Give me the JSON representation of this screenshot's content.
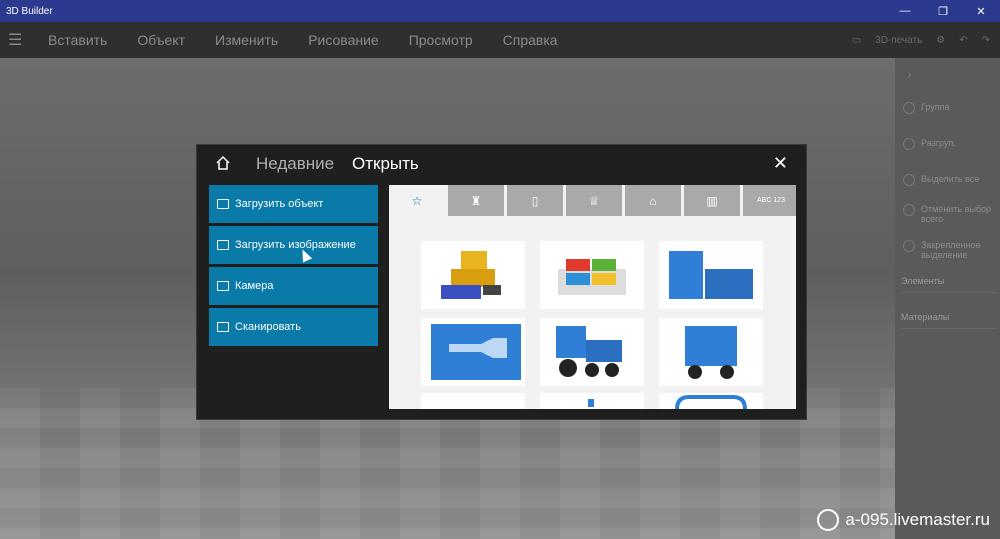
{
  "window": {
    "title": "3D Builder",
    "controls": [
      "—",
      "❐",
      "✕"
    ]
  },
  "menu": {
    "items": [
      "Вставить",
      "Объект",
      "Изменить",
      "Рисование",
      "Просмотр",
      "Справка"
    ],
    "print_label": "3D-печать"
  },
  "right_panel": {
    "items": [
      "Группа",
      "Разгруп.",
      "Выделить все",
      "Отменить выбор всего",
      "Закрепленное выделение"
    ],
    "sections": [
      "Элементы",
      "Материалы"
    ]
  },
  "dialog": {
    "tab_recent": "Недавние",
    "tab_open": "Открыть",
    "actions": [
      "Загрузить объект",
      "Загрузить изображение",
      "Камера",
      "Сканировать"
    ],
    "category_icons": [
      "star-icon",
      "robot-icon",
      "tag-icon",
      "trophy-icon",
      "house-icon",
      "buildings-icon",
      "text-icon"
    ],
    "text_tab_label": "ABC 123",
    "thumbnails": [
      "bulldozer",
      "windows-logo",
      "phone-stand",
      "bottle-mold",
      "train-engine",
      "train-wagon",
      "item-7",
      "item-8",
      "item-9"
    ]
  },
  "watermark": "a-095.livemaster.ru",
  "colors": {
    "titlebar": "#2b3a8f",
    "accent": "#0a7aa8",
    "model_blue": "#2f7fd6"
  }
}
